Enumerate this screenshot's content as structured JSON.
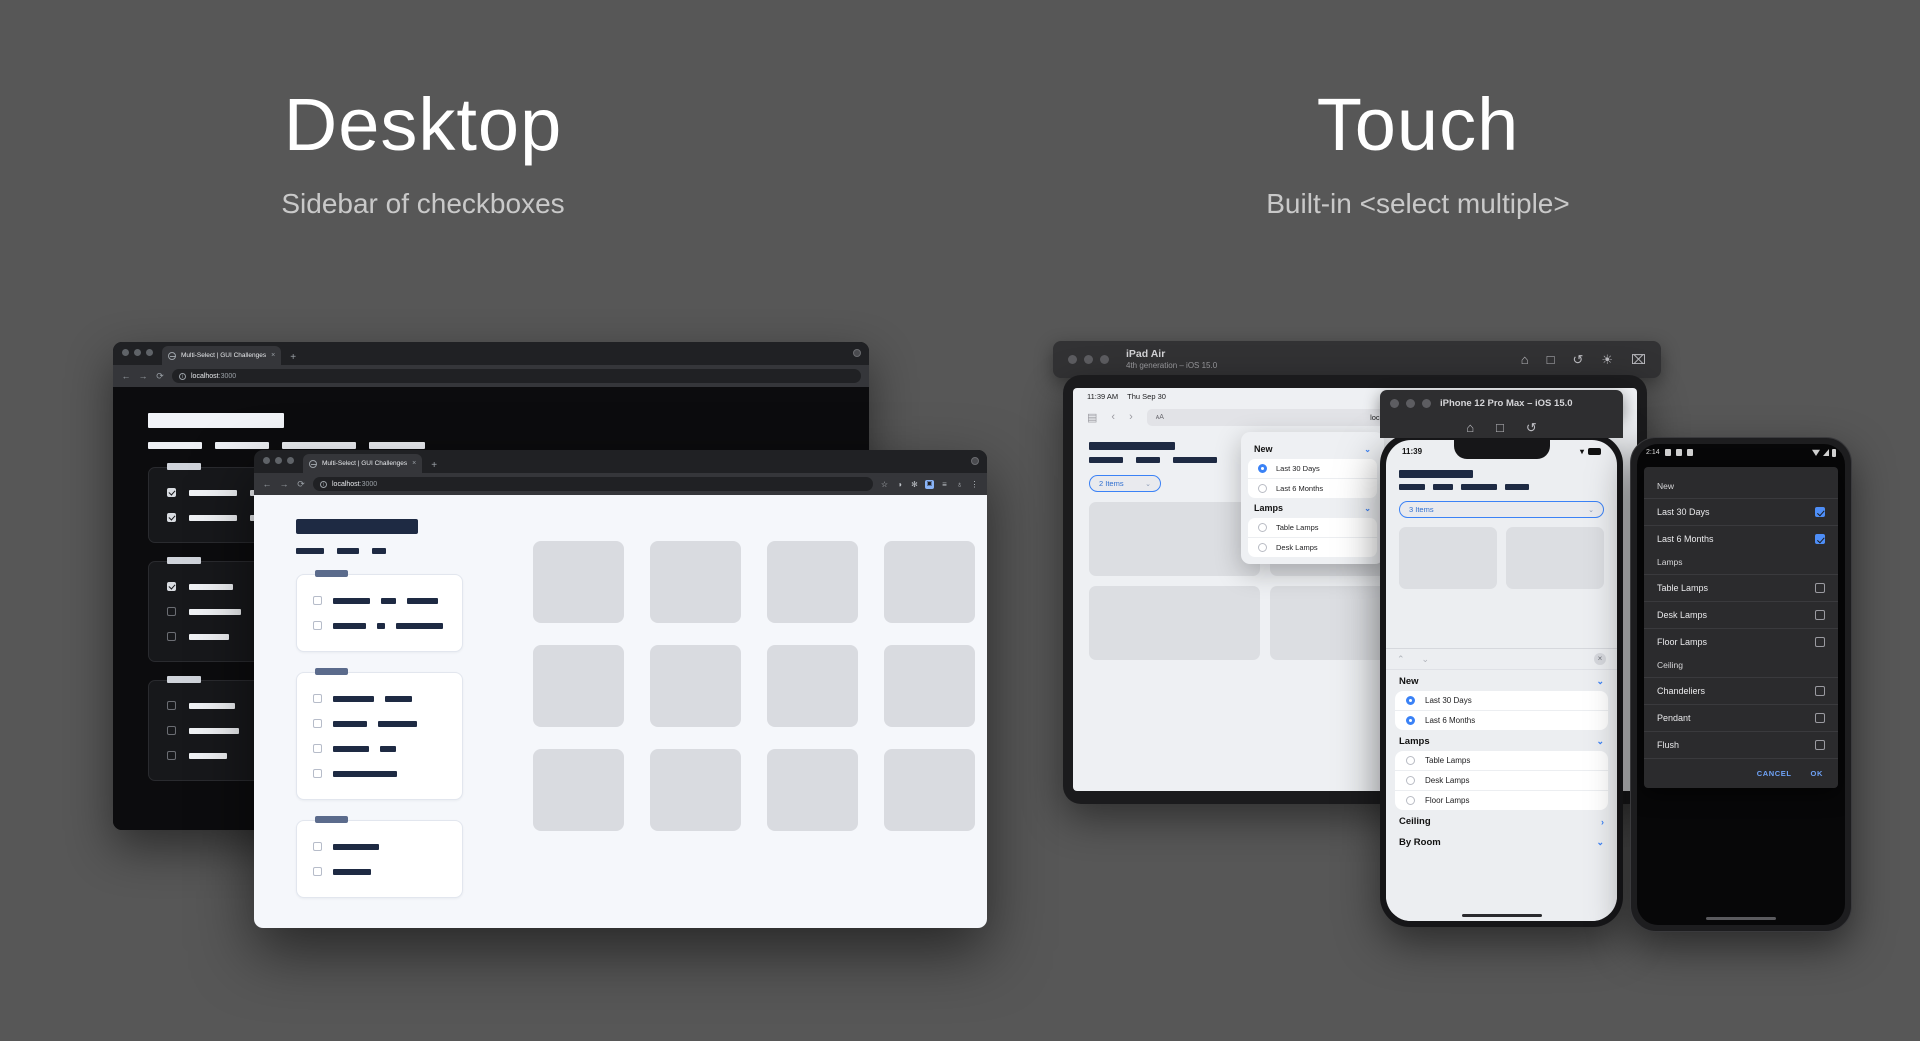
{
  "headings": {
    "desktop": {
      "title": "Desktop",
      "subtitle": "Sidebar of checkboxes"
    },
    "touch": {
      "title": "Touch",
      "subtitle": "Built-in <select multiple>"
    }
  },
  "browser": {
    "tab_title": "Multi-Select | GUI Challenges",
    "tab_close": "×",
    "new_tab": "+",
    "back": "←",
    "forward": "→",
    "reload": "⟳",
    "url_host": "localhost",
    "url_port": ":3000",
    "info_icon": "i",
    "extensions": [
      "star-icon",
      "compass-icon",
      "puzzle-icon",
      "cast-icon",
      "reading-list-icon",
      "mic-icon",
      "kebab-icon"
    ],
    "ext_glyphs": {
      "star": "☆",
      "compass": "◑",
      "puzzle": "✻",
      "cast": "▣",
      "reading_list": "≡",
      "mic": "♁",
      "kebab": "⋮"
    }
  },
  "ipad_sim": {
    "device_name": "iPad Air",
    "device_sub": "4th generation – iOS 15.0",
    "tools": [
      "home-icon",
      "screenshot-icon",
      "rotate-icon",
      "brightness-icon",
      "keyboard-icon"
    ],
    "tool_glyphs": [
      "⌂",
      "□",
      "↺",
      "☀",
      "⌧"
    ],
    "status_time": "11:39 AM",
    "status_date": "Thu Sep 30",
    "status_right": "•••",
    "safari": {
      "sidebar_icon": "▤",
      "back": "‹",
      "forward": "›",
      "aa_label": "ᴀA",
      "url": "localhost",
      "more": "⋯"
    },
    "select_pill": {
      "label": "2 Items",
      "caret": "⌄"
    },
    "popover": {
      "groups": [
        {
          "label": "New",
          "caret": "⌄",
          "options": [
            {
              "label": "Last 30 Days",
              "selected": true
            },
            {
              "label": "Last 6 Months",
              "selected": false
            }
          ]
        },
        {
          "label": "Lamps",
          "caret": "⌄",
          "options": [
            {
              "label": "Table Lamps",
              "selected": false
            },
            {
              "label": "Desk Lamps",
              "selected": false
            }
          ]
        }
      ]
    }
  },
  "iphone_sim": {
    "device_name": "iPhone 12 Pro Max – iOS 15.0",
    "tools": [
      "home-icon",
      "screenshot-icon",
      "rotate-icon"
    ],
    "tool_glyphs": [
      "⌂",
      "□",
      "↺"
    ],
    "status_time": "11:39",
    "status_wifi": "▾",
    "select_pill": {
      "label": "3 Items",
      "caret": "⌄"
    },
    "sheet": {
      "up_arrow": "⌃",
      "down_arrow": "⌄",
      "close": "×",
      "groups": [
        {
          "label": "New",
          "caret": "⌄",
          "options": [
            {
              "label": "Last 30 Days",
              "selected": true
            },
            {
              "label": "Last 6 Months",
              "selected": true
            }
          ]
        },
        {
          "label": "Lamps",
          "caret": "⌄",
          "options": [
            {
              "label": "Table Lamps",
              "selected": false
            },
            {
              "label": "Desk Lamps",
              "selected": false
            },
            {
              "label": "Floor Lamps",
              "selected": false
            }
          ]
        },
        {
          "label": "Ceiling",
          "caret": "›",
          "options": []
        },
        {
          "label": "By Room",
          "caret": "⌄",
          "options": []
        }
      ]
    }
  },
  "android_sim": {
    "status_time": "2:14",
    "dialog": {
      "groups": [
        {
          "label": "New",
          "options": [
            {
              "label": "Last 30 Days",
              "checked": true
            },
            {
              "label": "Last 6 Months",
              "checked": true
            }
          ]
        },
        {
          "label": "Lamps",
          "options": [
            {
              "label": "Table Lamps",
              "checked": false
            },
            {
              "label": "Desk Lamps",
              "checked": false
            },
            {
              "label": "Floor Lamps",
              "checked": false
            }
          ]
        },
        {
          "label": "Ceiling",
          "options": [
            {
              "label": "Chandeliers",
              "checked": false
            },
            {
              "label": "Pendant",
              "checked": false
            },
            {
              "label": "Flush",
              "checked": false
            }
          ]
        }
      ],
      "cancel_label": "CANCEL",
      "ok_label": "OK"
    }
  },
  "colors": {
    "page_background": "#575757",
    "accent_blue": "#3b82f6",
    "android_blue": "#6ea2f7",
    "ink_navy": "#1e2a43",
    "light_page": "#f5f7fb",
    "placeholder_grey": "#d9dbe0"
  }
}
